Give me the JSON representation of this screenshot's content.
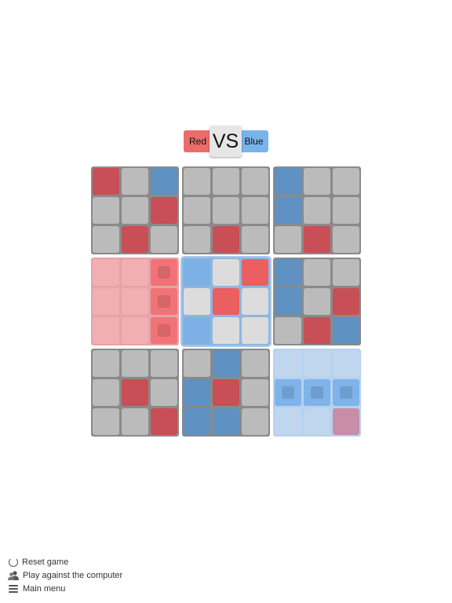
{
  "header": {
    "red_label": "Red",
    "vs_label": "VS",
    "blue_label": "Blue"
  },
  "board": {
    "boards": [
      {
        "state": "normal",
        "cells": [
          "red",
          "empty",
          "blue",
          "empty",
          "empty",
          "red",
          "empty",
          "red",
          "empty"
        ]
      },
      {
        "state": "normal",
        "cells": [
          "empty",
          "empty",
          "empty",
          "empty",
          "empty",
          "empty",
          "empty",
          "red",
          "empty"
        ]
      },
      {
        "state": "normal",
        "cells": [
          "blue",
          "empty",
          "empty",
          "blue",
          "empty",
          "empty",
          "empty",
          "red",
          "empty"
        ]
      },
      {
        "state": "won-red",
        "cells": [
          "empty",
          "empty",
          "red",
          "empty",
          "empty",
          "red",
          "empty",
          "empty",
          "red"
        ],
        "marked": [
          2,
          5,
          8
        ]
      },
      {
        "state": "active",
        "cells": [
          "blue",
          "empty",
          "red",
          "empty",
          "red",
          "empty",
          "blue",
          "empty",
          "empty"
        ]
      },
      {
        "state": "normal",
        "cells": [
          "blue",
          "empty",
          "empty",
          "blue",
          "empty",
          "red",
          "empty",
          "red",
          "blue"
        ]
      },
      {
        "state": "normal",
        "cells": [
          "empty",
          "empty",
          "empty",
          "empty",
          "red",
          "empty",
          "empty",
          "empty",
          "red"
        ]
      },
      {
        "state": "normal",
        "cells": [
          "empty",
          "blue",
          "empty",
          "blue",
          "red",
          "empty",
          "blue",
          "blue",
          "empty"
        ]
      },
      {
        "state": "won-blue",
        "cells": [
          "empty",
          "empty",
          "empty",
          "blue",
          "blue",
          "blue",
          "empty",
          "empty",
          "red"
        ],
        "marked": [
          3,
          4,
          5
        ]
      }
    ]
  },
  "menu": {
    "reset_label": "Reset game",
    "play_computer_label": "Play against the computer",
    "main_menu_label": "Main menu"
  },
  "colors": {
    "red": "#ec6b6b",
    "blue": "#78b4ea",
    "board_border": "#8a8a8a"
  },
  "icons": [
    "reset-icon",
    "people-icon",
    "menu-icon"
  ]
}
